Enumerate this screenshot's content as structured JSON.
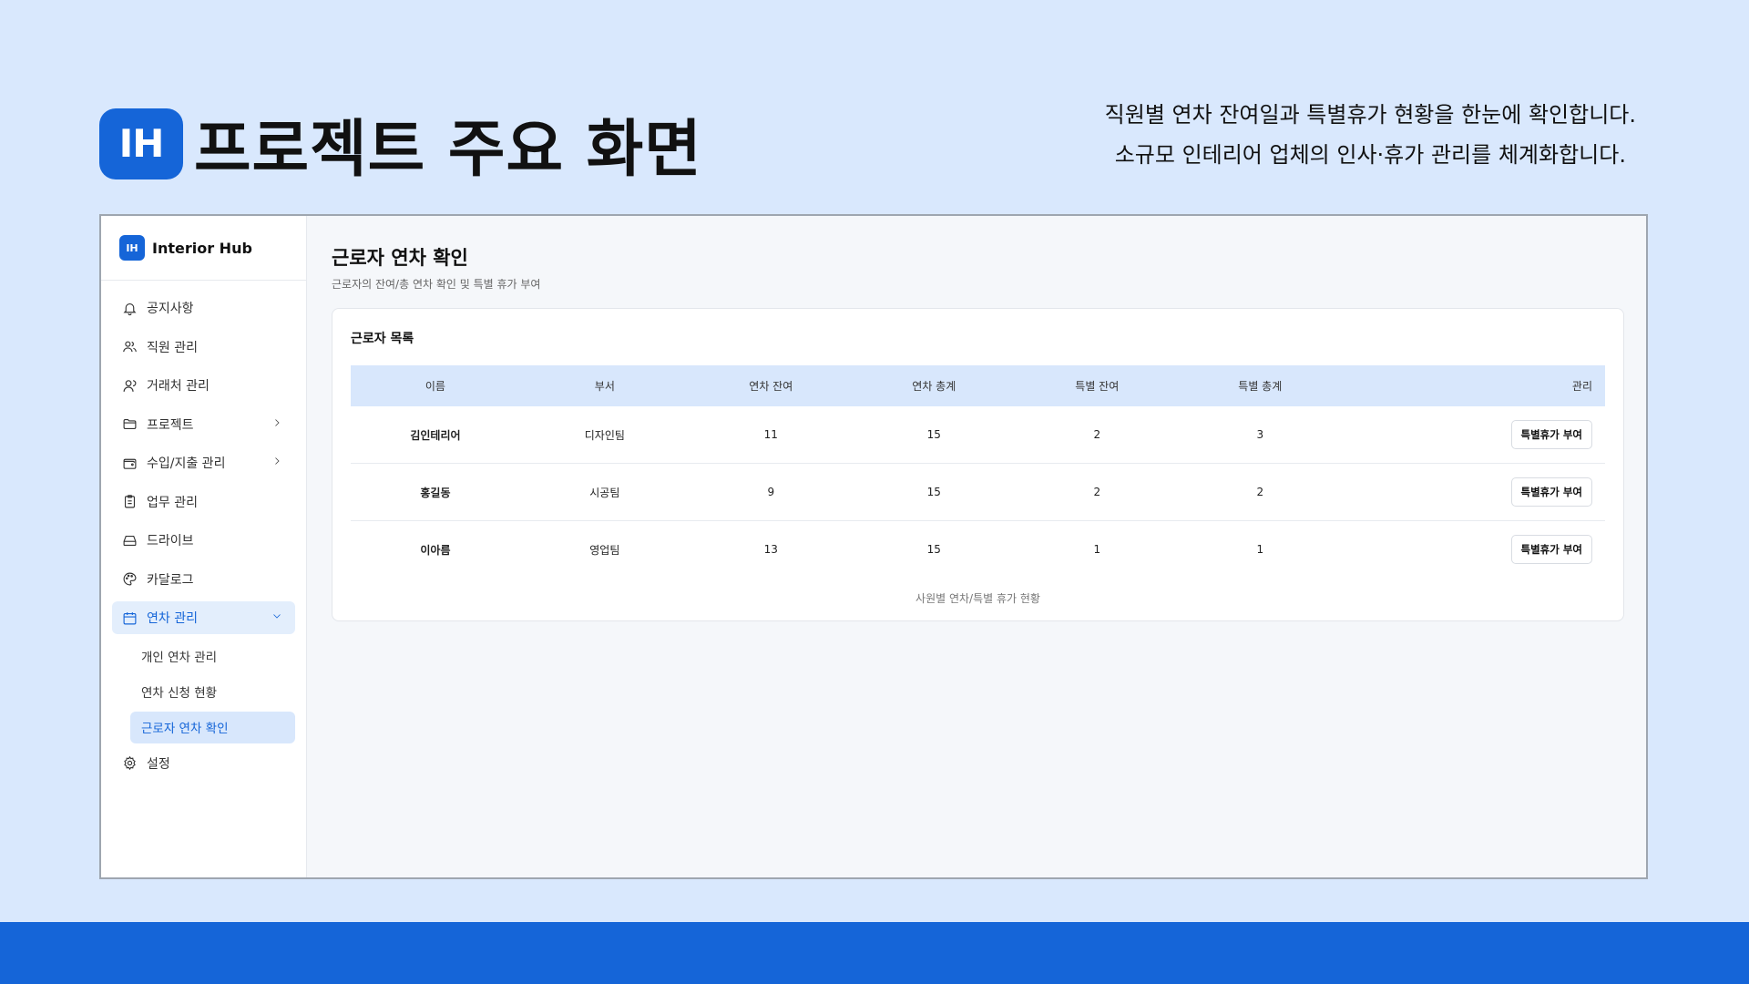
{
  "slide": {
    "logo": "IH",
    "title": "프로젝트 주요 화면",
    "desc": [
      "직원별 연차 잔여일과 특별휴가 현황을 한눈에 확인합니다.",
      "소규모 인테리어 업체의 인사·휴가 관리를 체계화합니다."
    ]
  },
  "colors": {
    "brand": "#1565d8",
    "background": "#d9e8fd",
    "active_bg": "#e3eefc",
    "table_header_bg": "#d8e7fc"
  },
  "app": {
    "brand_badge": "IH",
    "brand_name": "Interior Hub",
    "nav": [
      {
        "label": "공지사항",
        "icon": "bell-icon"
      },
      {
        "label": "직원 관리",
        "icon": "users-icon"
      },
      {
        "label": "거래처 관리",
        "icon": "user-group-icon"
      },
      {
        "label": "프로젝트",
        "icon": "folder-icon",
        "chevron": "right"
      },
      {
        "label": "수입/지출 관리",
        "icon": "wallet-icon",
        "chevron": "right"
      },
      {
        "label": "업무 관리",
        "icon": "clipboard-icon"
      },
      {
        "label": "드라이브",
        "icon": "drive-icon"
      },
      {
        "label": "카달로그",
        "icon": "palette-icon"
      },
      {
        "label": "연차 관리",
        "icon": "calendar-icon",
        "chevron": "down",
        "active": true
      },
      {
        "label": "설정",
        "icon": "gear-icon"
      }
    ],
    "sub_nav": [
      {
        "label": "개인 연차 관리"
      },
      {
        "label": "연차 신청 현황"
      },
      {
        "label": "근로자 연차 확인",
        "active": true
      }
    ],
    "page": {
      "title": "근로자 연차 확인",
      "subtitle": "근로자의 잔여/총 연차 확인 및 특별 휴가 부여",
      "card_title": "근로자 목록",
      "columns": [
        "이름",
        "부서",
        "연차 잔여",
        "연차 총계",
        "특별 잔여",
        "특별 총계",
        "관리"
      ],
      "rows": [
        {
          "name": "김인테리어",
          "dept": "디자인팀",
          "annual_left": "11",
          "annual_total": "15",
          "special_left": "2",
          "special_total": "3",
          "action": "특별휴가 부여"
        },
        {
          "name": "홍길동",
          "dept": "시공팀",
          "annual_left": "9",
          "annual_total": "15",
          "special_left": "2",
          "special_total": "2",
          "action": "특별휴가 부여"
        },
        {
          "name": "이아름",
          "dept": "영업팀",
          "annual_left": "13",
          "annual_total": "15",
          "special_left": "1",
          "special_total": "1",
          "action": "특별휴가 부여"
        }
      ],
      "caption": "사원별 연차/특별 휴가 현황"
    }
  }
}
